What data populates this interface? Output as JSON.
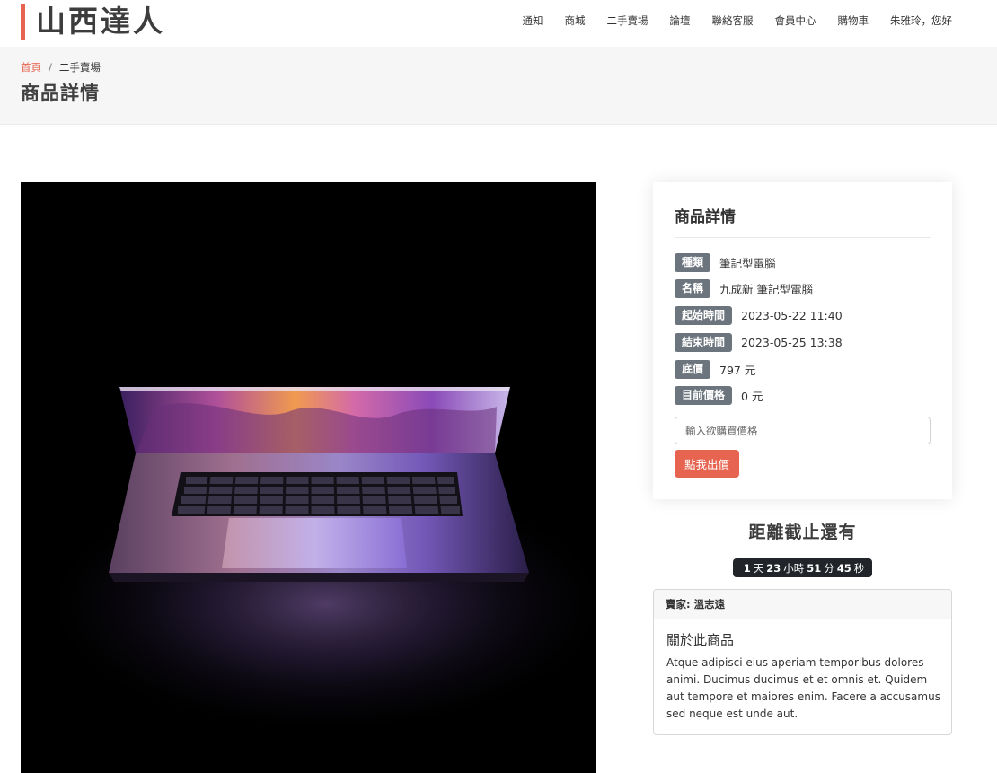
{
  "brand": {
    "logo_text": "山西達人",
    "accent": "#e76451"
  },
  "nav": [
    "通知",
    "商城",
    "二手賣場",
    "論壇",
    "聯絡客服",
    "會員中心",
    "購物車",
    "朱雅玲，您好"
  ],
  "breadcrumb": {
    "home": "首頁",
    "separator": "/",
    "current": "二手賣場"
  },
  "page_title": "商品詳情",
  "product": {
    "image": "laptop-photo"
  },
  "detail_card": {
    "title": "商品詳情",
    "rows": [
      {
        "label": "種類",
        "value": "筆記型電腦"
      },
      {
        "label": "名稱",
        "value": "九成新 筆記型電腦"
      },
      {
        "label": "起始時間",
        "value": "2023-05-22 11:40"
      },
      {
        "label": "結束時間",
        "value": "2023-05-25 13:38"
      },
      {
        "label": "底價",
        "value": "797 元"
      },
      {
        "label": "目前價格",
        "value": "0 元"
      }
    ],
    "bid_placeholder": "輸入欲購買價格",
    "bid_value": "",
    "bid_button": "點我出價"
  },
  "countdown": {
    "title": "距離截止還有",
    "days": "1",
    "days_unit": "天",
    "hours": "23",
    "hours_unit": "小時",
    "minutes": "51",
    "minutes_unit": "分",
    "seconds": "45",
    "seconds_unit": "秒"
  },
  "seller": {
    "label": "賣家:",
    "name": "溫志遠",
    "about_title": "關於此商品",
    "about_text": "Atque adipisci eius aperiam temporibus dolores animi. Ducimus ducimus et et omnis et. Quidem aut tempore et maiores enim. Facere a accusamus sed neque est unde aut."
  }
}
